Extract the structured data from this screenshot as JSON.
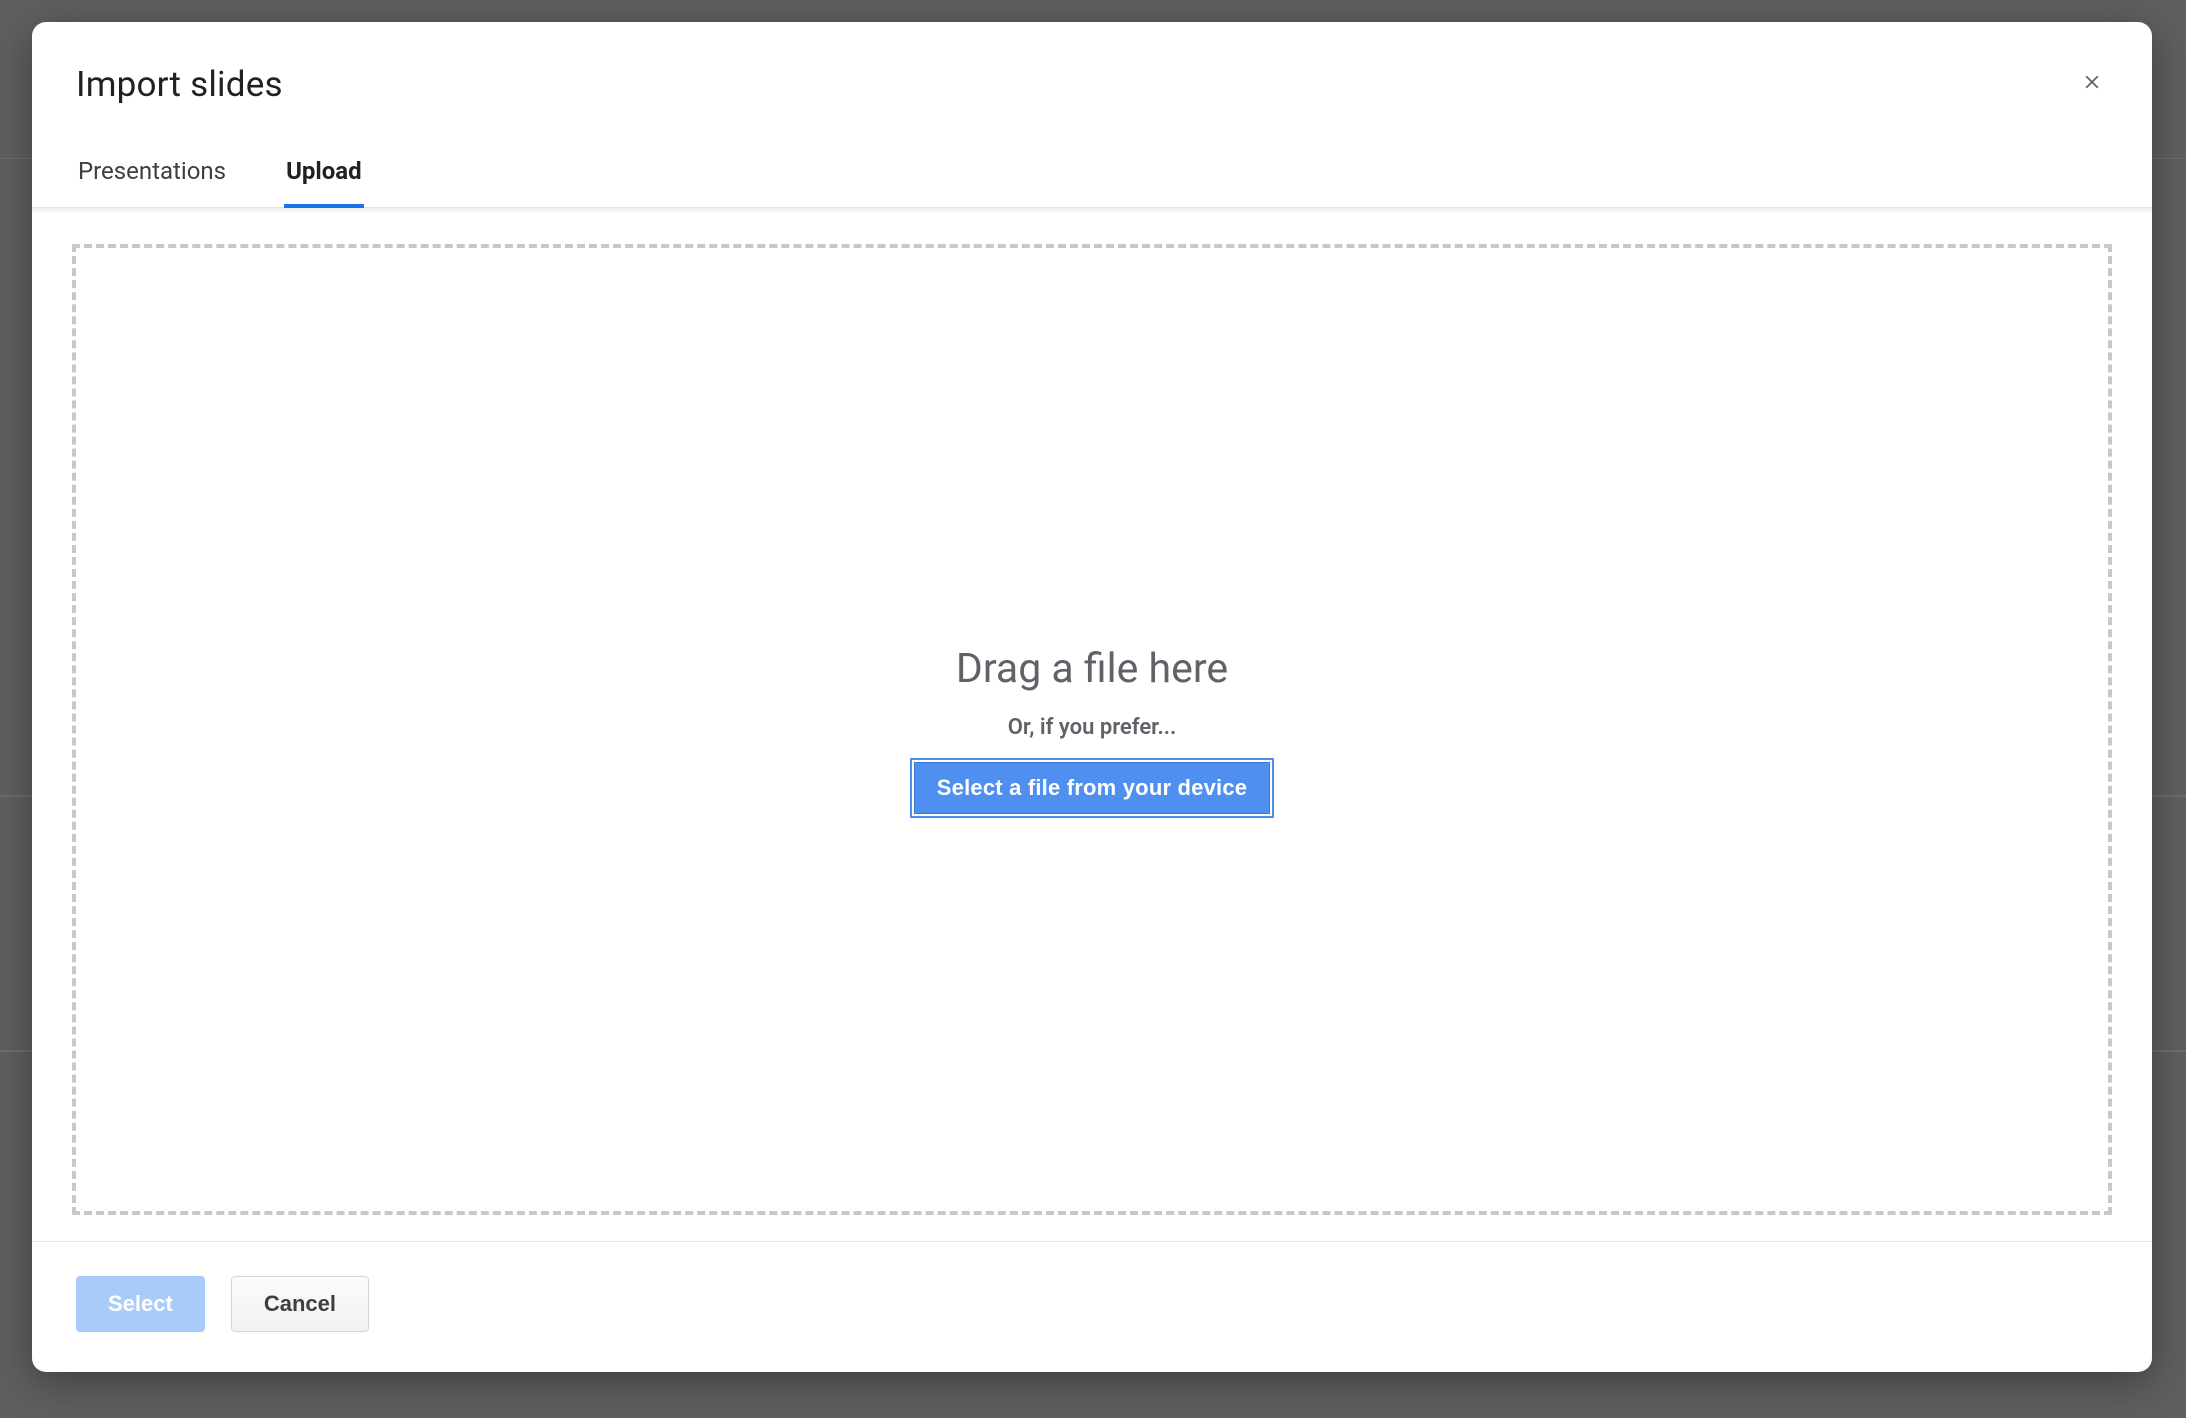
{
  "dialog": {
    "title": "Import slides",
    "tabs": [
      {
        "label": "Presentations",
        "active": false
      },
      {
        "label": "Upload",
        "active": true
      }
    ],
    "dropzone": {
      "headline": "Drag a file here",
      "subtext": "Or, if you prefer...",
      "button_label": "Select a file from your device"
    },
    "footer": {
      "primary_label": "Select",
      "primary_enabled": false,
      "secondary_label": "Cancel"
    }
  }
}
